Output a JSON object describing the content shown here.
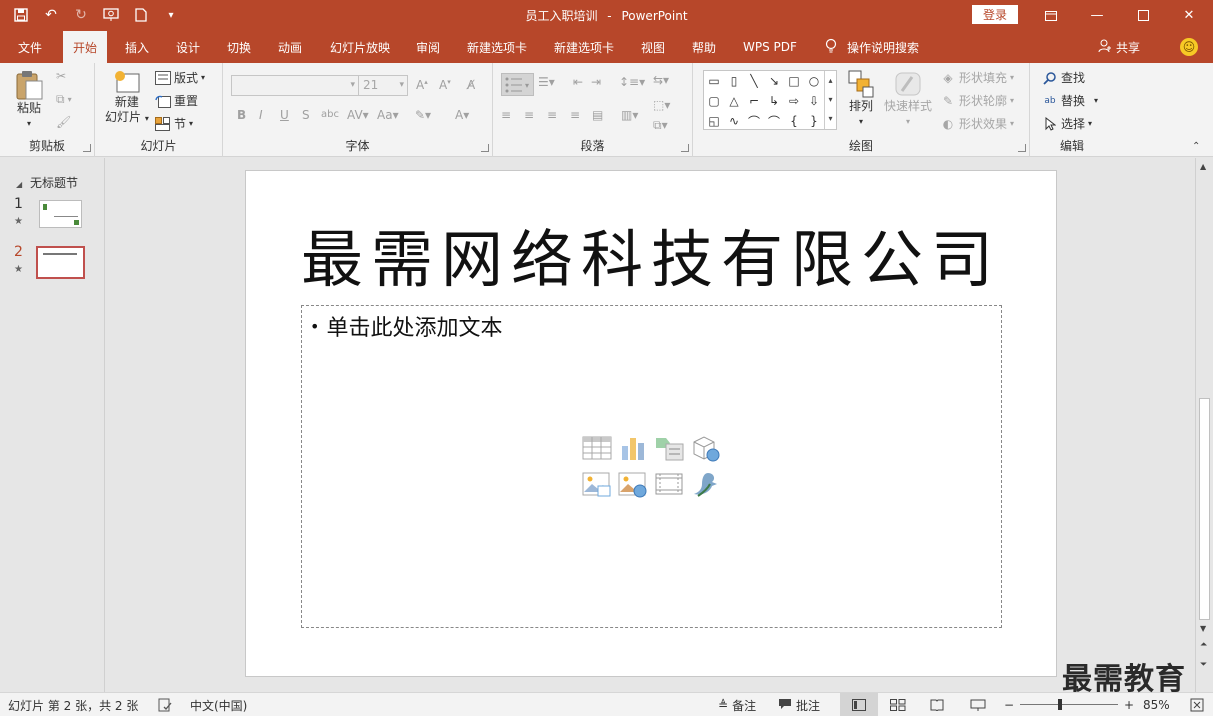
{
  "titlebar": {
    "document_title": "员工入职培训",
    "separator": "-",
    "app_name": "PowerPoint",
    "login_label": "登录"
  },
  "tabs": [
    {
      "label": "文件"
    },
    {
      "label": "开始"
    },
    {
      "label": "插入"
    },
    {
      "label": "设计"
    },
    {
      "label": "切换"
    },
    {
      "label": "动画"
    },
    {
      "label": "幻灯片放映"
    },
    {
      "label": "审阅"
    },
    {
      "label": "新建选项卡"
    },
    {
      "label": "新建选项卡"
    },
    {
      "label": "视图"
    },
    {
      "label": "帮助"
    },
    {
      "label": "WPS PDF"
    }
  ],
  "tell_me": "操作说明搜索",
  "share": "共享",
  "ribbon": {
    "clipboard": {
      "paste": "粘贴",
      "label": "剪贴板"
    },
    "slides": {
      "new_slide_1": "新建",
      "new_slide_2": "幻灯片",
      "layout": "版式",
      "reset": "重置",
      "section": "节",
      "label": "幻灯片"
    },
    "font": {
      "size": "21",
      "label": "字体"
    },
    "paragraph": {
      "label": "段落"
    },
    "drawing": {
      "arrange": "排列",
      "quick_styles": "快速样式",
      "shape_fill": "形状填充",
      "shape_outline": "形状轮廓",
      "shape_effects": "形状效果",
      "label": "绘图"
    },
    "editing": {
      "find": "查找",
      "replace": "替换",
      "select": "选择",
      "label": "编辑"
    }
  },
  "thumbnails": {
    "section_name": "无标题节",
    "slides": [
      {
        "number": "1"
      },
      {
        "number": "2"
      }
    ]
  },
  "slide": {
    "title": "最需网络科技有限公司",
    "placeholder_text": "单击此处添加文本"
  },
  "statusbar": {
    "slide_info": "幻灯片 第 2 张，共 2 张",
    "language": "中文(中国)",
    "notes": "备注",
    "comments": "批注",
    "zoom": "85%"
  },
  "watermark": "最需教育",
  "colors": {
    "accent": "#b7472a",
    "ribbon_bg": "#f3f3f3",
    "workspace_bg": "#e6e6e6"
  }
}
